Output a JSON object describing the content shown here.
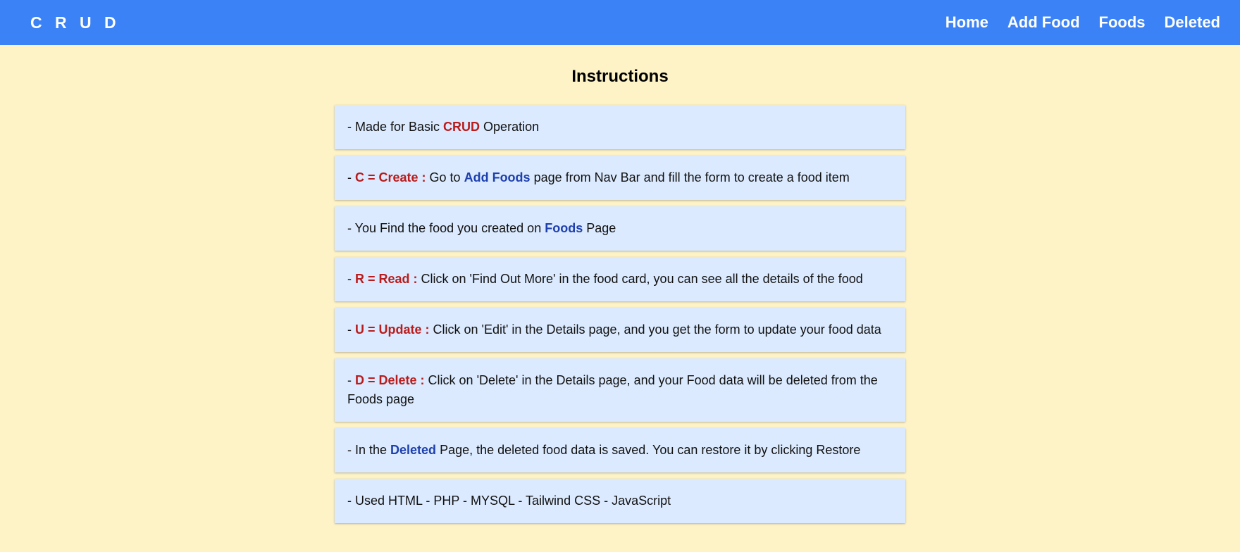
{
  "header": {
    "brand": "C R U D",
    "nav": [
      "Home",
      "Add Food",
      "Foods",
      "Deleted"
    ]
  },
  "main": {
    "title": "Instructions",
    "items": [
      {
        "prefix": "- Made for Basic ",
        "red": "CRUD",
        "suffix": " Operation"
      },
      {
        "prefix": "- ",
        "red": "C = Create :",
        "middle": " Go to ",
        "blue": "Add Foods",
        "suffix": " page from Nav Bar and fill the form to create a food item"
      },
      {
        "prefix": "- You Find the food you created on ",
        "blue": "Foods",
        "suffix": " Page"
      },
      {
        "prefix": "- ",
        "red": "R = Read :",
        "suffix": " Click on 'Find Out More' in the food card, you can see all the details of the food"
      },
      {
        "prefix": "- ",
        "red": "U = Update :",
        "suffix": " Click on 'Edit' in the Details page, and you get the form to update your food data"
      },
      {
        "prefix": "- ",
        "red": "D = Delete :",
        "suffix": " Click on 'Delete' in the Details page, and your Food data will be deleted from the Foods page"
      },
      {
        "prefix": "- In the ",
        "blue": "Deleted",
        "suffix": " Page, the deleted food data is saved. You can restore it by clicking Restore"
      },
      {
        "prefix": "- Used HTML - PHP - MYSQL - Tailwind CSS - JavaScript"
      }
    ]
  },
  "colors": {
    "navbar": "#3b82f6",
    "background": "#fef3c7",
    "card": "#dbeafe",
    "accent_red": "#b91c1c",
    "accent_blue": "#1e40af"
  }
}
